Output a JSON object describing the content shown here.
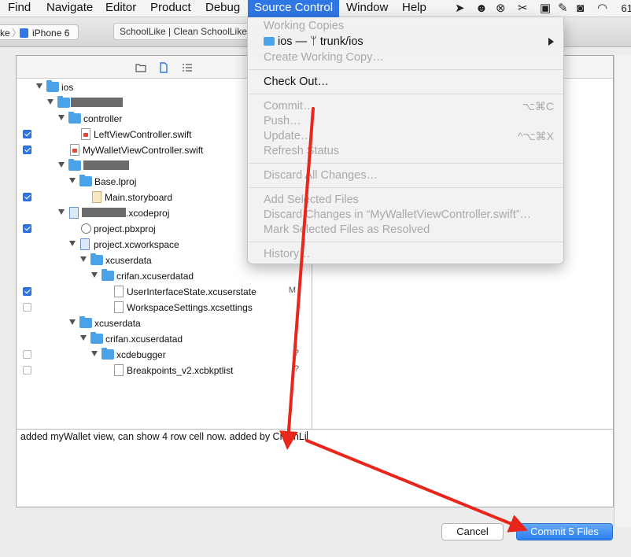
{
  "menubar": {
    "items": [
      "Find",
      "Navigate",
      "Editor",
      "Product",
      "Debug",
      "Source Control",
      "Window",
      "Help"
    ],
    "active": "Source Control",
    "battery_text": "61"
  },
  "toolbar": {
    "scheme_partial": "ke",
    "scheme_sep": "〉",
    "device": "iPhone 6",
    "activity_text": "SchoolLike  |  Clean SchoolLike"
  },
  "source_control_menu": {
    "working_copies_header": "Working Copies",
    "working_copy_entry": "ios — ",
    "working_copy_branch": "trunk/ios",
    "branch_glyph": "ᛘ",
    "create_working_copy": "Create Working Copy…",
    "check_out": "Check Out…",
    "commit": "Commit…",
    "commit_shortcut": "⌥⌘C",
    "push": "Push…",
    "update": "Update…",
    "update_shortcut": "^⌥⌘X",
    "refresh_status": "Refresh Status",
    "discard_all": "Discard All Changes…",
    "add_selected": "Add Selected Files",
    "discard_changes_in": "Discard Changes in “MyWalletViewController.swift”…",
    "mark_resolved": "Mark Selected Files as Resolved",
    "history": "History…"
  },
  "file_tree": [
    {
      "name": "ios",
      "kind": "folder",
      "checked": null,
      "status": ""
    },
    {
      "name": "",
      "kind": "folder",
      "checked": null,
      "status": ""
    },
    {
      "name": "controller",
      "kind": "folder",
      "checked": null,
      "status": ""
    },
    {
      "name": "LeftViewController.swift",
      "kind": "swift",
      "checked": true,
      "status": ""
    },
    {
      "name": "MyWalletViewController.swift",
      "kind": "swift",
      "checked": true,
      "status": ""
    },
    {
      "name": "",
      "kind": "folder",
      "checked": null,
      "status": ""
    },
    {
      "name": "Base.lproj",
      "kind": "folder",
      "checked": null,
      "status": ""
    },
    {
      "name": "Main.storyboard",
      "kind": "storyboard",
      "checked": true,
      "status": ""
    },
    {
      "name": ".xcodeproj",
      "kind": "xcodeproj",
      "checked": null,
      "status": ""
    },
    {
      "name": "project.pbxproj",
      "kind": "pbxproj",
      "checked": true,
      "status": ""
    },
    {
      "name": "project.xcworkspace",
      "kind": "workspace",
      "checked": null,
      "status": ""
    },
    {
      "name": "xcuserdata",
      "kind": "folder",
      "checked": null,
      "status": ""
    },
    {
      "name": "crifan.xcuserdatad",
      "kind": "folder",
      "checked": null,
      "status": ""
    },
    {
      "name": "UserInterfaceState.xcuserstate",
      "kind": "doc",
      "checked": true,
      "status": "M"
    },
    {
      "name": "WorkspaceSettings.xcsettings",
      "kind": "doc",
      "checked": false,
      "status": ""
    },
    {
      "name": "xcuserdata",
      "kind": "folder",
      "checked": null,
      "status": ""
    },
    {
      "name": "crifan.xcuserdatad",
      "kind": "folder",
      "checked": null,
      "status": ""
    },
    {
      "name": "xcdebugger",
      "kind": "folder",
      "checked": false,
      "status": "?"
    },
    {
      "name": "Breakpoints_v2.xcbkptlist",
      "kind": "doc",
      "checked": false,
      "status": "?"
    }
  ],
  "commit_message": "added myWallet view, can show 4 row cell now. added by CrifanLi",
  "buttons": {
    "cancel": "Cancel",
    "commit": "Commit 5 Files"
  },
  "colors": {
    "accent": "#2f77e4",
    "annotation_arrow": "#e8271c",
    "folder": "#4aa3e8"
  }
}
